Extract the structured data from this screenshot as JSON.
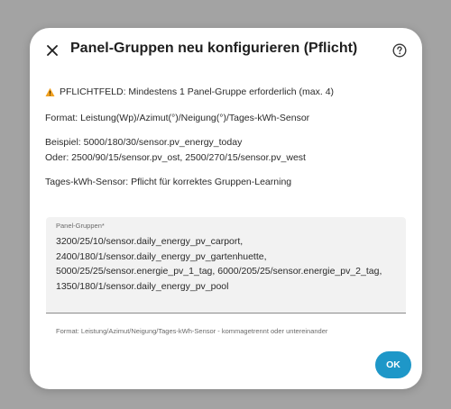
{
  "dialog": {
    "title": "Panel-Gruppen neu konfigurieren (Pflicht)",
    "icons": {
      "close": "close-icon",
      "help": "help-circle-icon",
      "warning": "warning-icon"
    },
    "warning_text": "PFLICHTFELD: Mindestens 1 Panel-Gruppe erforderlich (max. 4)",
    "format_text": "Format: Leistung(Wp)/Azimut(°)/Neigung(°)/Tages-kWh-Sensor",
    "example_line1": "Beispiel: 5000/180/30/sensor.pv_energy_today",
    "example_line2": "Oder: 2500/90/15/sensor.pv_ost, 2500/270/15/sensor.pv_west",
    "daily_sensor_text": "Tages-kWh-Sensor: Pflicht für korrektes Gruppen-Learning",
    "field": {
      "label": "Panel-Gruppen*",
      "value": "3200/25/10/sensor.daily_energy_pv_carport,\n2400/180/1/sensor.daily_energy_pv_gartenhuette,\n5000/25/25/sensor.energie_pv_1_tag, 6000/205/25/sensor.energie_pv_2_tag,\n1350/180/1/sensor.daily_energy_pv_pool",
      "helper": "Format: Leistung/Azimut/Neigung/Tages-kWh-Sensor - kommagetrennt oder untereinander"
    },
    "ok_label": "OK",
    "colors": {
      "accent": "#1e97c8",
      "warning": "#f0a020",
      "backdrop": "#a3a3a3"
    }
  }
}
